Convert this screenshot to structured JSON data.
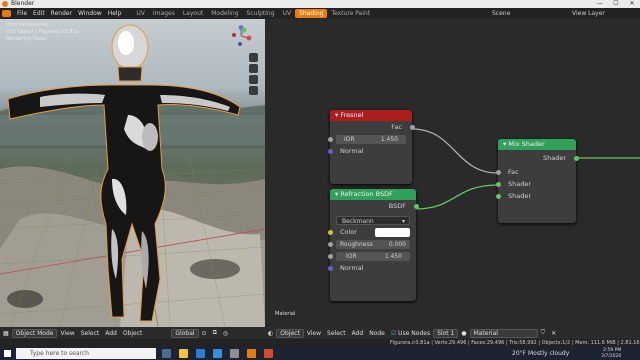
{
  "window": {
    "title": "Blender",
    "controls": [
      "—",
      "☐",
      "✕"
    ]
  },
  "menubar": {
    "menus": [
      "File",
      "Edit",
      "Render",
      "Window",
      "Help"
    ],
    "workspaces": [
      {
        "label": "UV",
        "active": false
      },
      {
        "label": "Images",
        "active": false
      },
      {
        "label": "Layout",
        "active": false
      },
      {
        "label": "Modeling",
        "active": false
      },
      {
        "label": "Sculpting",
        "active": false
      },
      {
        "label": "UV",
        "active": false
      },
      {
        "label": "Shading",
        "active": true
      },
      {
        "label": "Texture Paint",
        "active": false
      }
    ],
    "scene": "Scene",
    "view_layer": "View Layer"
  },
  "viewport": {
    "overlay_lines": [
      "User Perspective",
      "(10) Object | Figurora.ir3.81a",
      "Rendering Done"
    ],
    "header": {
      "mode": "Object Mode",
      "menus": [
        "View",
        "Select",
        "Add",
        "Object"
      ],
      "orientation": "Global"
    }
  },
  "node_editor": {
    "label": "Material",
    "nodes": {
      "fresnel": {
        "title": "Fresnel",
        "output": "Fac",
        "ior_label": "IOR",
        "ior_value": "1.450",
        "normal_label": "Normal",
        "header_color": "#ad1d1d"
      },
      "refraction": {
        "title": "Refraction BSDF",
        "output": "BSDF",
        "distribution": "Beckmann",
        "color_label": "Color",
        "roughness_label": "Roughness",
        "roughness_value": "0.000",
        "ior_label": "IOR",
        "ior_value": "1.450",
        "normal_label": "Normal",
        "header_color": "#2fa15a"
      },
      "mix": {
        "title": "Mix Shader",
        "output": "Shader",
        "inputs": [
          "Fac",
          "Shader",
          "Shader"
        ],
        "header_color": "#2fa15a"
      }
    },
    "header": {
      "type": "Object",
      "menus": [
        "View",
        "Select",
        "Add",
        "Node"
      ],
      "use_nodes": "Use Nodes",
      "slot": "Slot 1",
      "material": "Material"
    }
  },
  "statusbar": {
    "stats": "Figurora.ir3.81a | Verts:29,496 | Faces:29,496 | Tris:58,992 | Objects:1/2 | Mem: 111.6 MiB | 2.81.16"
  },
  "taskbar": {
    "search_placeholder": "Type here to search",
    "weather": "20°F  Mostly cloudy",
    "time": "2:59 PM",
    "date": "3/7/2020"
  }
}
